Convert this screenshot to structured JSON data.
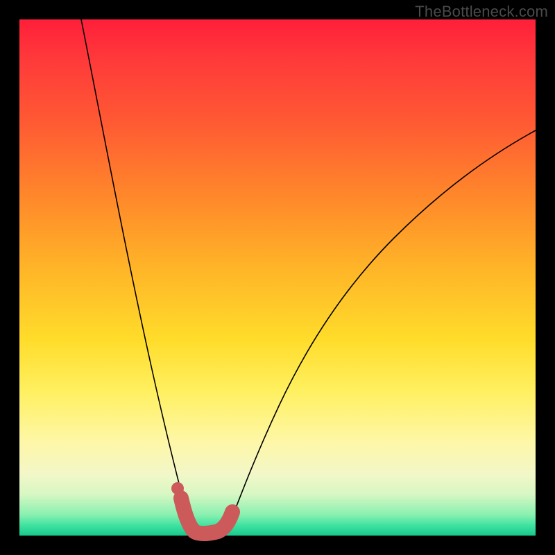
{
  "watermark": "TheBottleneck.com",
  "colors": {
    "frame": "#000000",
    "thick_stroke": "#cc5a5a",
    "thin_stroke": "#000000",
    "gradient_top": "#ff1f3a",
    "gradient_bottom": "#18c88c"
  },
  "chart_data": {
    "type": "line",
    "title": "",
    "xlabel": "",
    "ylabel": "",
    "xlim": [
      0,
      100
    ],
    "ylim": [
      0,
      100
    ],
    "grid": false,
    "legend": false,
    "note": "No axis ticks or numeric labels are rendered; values estimated from pixel positions on a 0-100 normalized scale. y=0 at bottom, y=100 at top.",
    "series": [
      {
        "name": "left-descending-curve",
        "x": [
          12,
          15,
          18,
          21,
          24,
          26,
          28,
          30,
          31,
          32,
          33
        ],
        "y": [
          100,
          82,
          64,
          48,
          33,
          23,
          15,
          8,
          5,
          3,
          2
        ]
      },
      {
        "name": "right-ascending-curve",
        "x": [
          40,
          42,
          45,
          50,
          56,
          63,
          72,
          82,
          92,
          100
        ],
        "y": [
          2,
          5,
          12,
          25,
          39,
          52,
          63,
          72,
          78,
          82
        ]
      },
      {
        "name": "highlight-valley-segment",
        "stroke_width": "thick",
        "color": "#cc5a5a",
        "x": [
          31,
          32,
          33,
          34,
          36,
          38,
          40,
          41
        ],
        "y": [
          7,
          3,
          1,
          0,
          0,
          0,
          2,
          5
        ]
      }
    ],
    "points": [
      {
        "name": "highlight-dot",
        "x": 30.5,
        "y": 9,
        "color": "#cc5a5a"
      }
    ],
    "background_gradient": {
      "direction": "top-to-bottom",
      "stops": [
        {
          "pos": 0,
          "color": "#ff1f3a"
        },
        {
          "pos": 35,
          "color": "#ff8a2a"
        },
        {
          "pos": 62,
          "color": "#ffdc2a"
        },
        {
          "pos": 88,
          "color": "#f3f7c8"
        },
        {
          "pos": 100,
          "color": "#18c88c"
        }
      ]
    }
  }
}
